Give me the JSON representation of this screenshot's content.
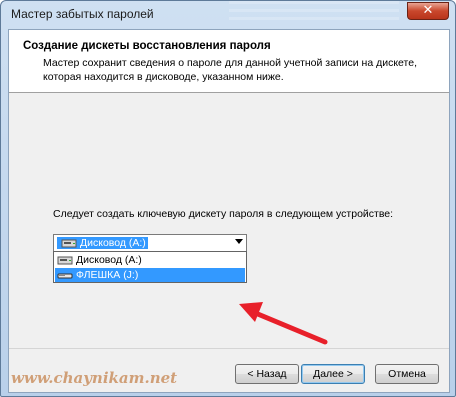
{
  "window": {
    "title": "Мастер забытых паролей",
    "close_glyph": "✕"
  },
  "header": {
    "title": "Создание дискеты восстановления пароля",
    "description": "Мастер сохранит сведения о пароле для данной учетной записи на дискете, которая находится в дисководе, указанном ниже."
  },
  "device": {
    "prompt": "Следует создать ключевую дискету пароля в следующем устройстве:",
    "selected": "Дисковод (A:)",
    "options": [
      {
        "label": "Дисковод (A:)",
        "icon": "floppy-drive-icon",
        "highlighted": false
      },
      {
        "label": "ФЛЕШКА (J:)",
        "icon": "removable-drive-icon",
        "highlighted": true
      }
    ]
  },
  "buttons": {
    "back": "< Назад",
    "next": "Далее >",
    "cancel": "Отмена"
  },
  "watermark": "www.chaynikam.net",
  "colors": {
    "selection": "#3399ff",
    "annotation_arrow": "#e8202a",
    "close_button": "#c9472c"
  }
}
